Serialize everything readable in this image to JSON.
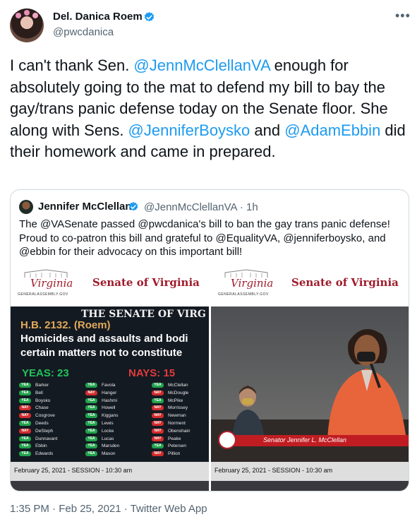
{
  "author": {
    "name": "Del. Danica Roem",
    "handle": "@pwcdanica"
  },
  "menu_icon": "more-horizontal-icon",
  "tweet": {
    "text_parts": [
      {
        "text": "I can't thank Sen. ",
        "mention": false
      },
      {
        "text": "@JennMcClellanVA",
        "mention": true
      },
      {
        "text": " enough for absolutely going to the mat to defend my bill to bay the gay/trans panic defense today on the Senate floor. She along with Sens. ",
        "mention": false
      },
      {
        "text": "@JenniferBoysko",
        "mention": true
      },
      {
        "text": " and ",
        "mention": false
      },
      {
        "text": "@AdamEbbin",
        "mention": true
      },
      {
        "text": " did their homework and came in prepared.",
        "mention": false
      }
    ]
  },
  "quote": {
    "name": "Jennifer McClellan",
    "handle_time": "@JennMcClellanVA · 1h",
    "text": "The @VASenate passed @pwcdanica's bill to ban the gay trans panic defense! Proud to co-patron this bill and grateful to @EqualityVA, @jenniferboysko, and @ebbin for their advocacy on this important bill!",
    "media": {
      "logo_script": "Virginia",
      "logo_small": "GENERALASSEMBLY.GOV",
      "senate_title": "Senate of Virginia",
      "vote_screen": {
        "title": "THE SENATE OF VIRG",
        "bill": "H.B. 2132. (Roem)",
        "desc_line1": "Homicides and assaults and bodi",
        "desc_line2": "certain matters not to constitute",
        "yeas": "YEAS: 23",
        "nays": "NAYS: 15",
        "columns": [
          [
            {
              "vote": "YEA",
              "name": "Barker"
            },
            {
              "vote": "YEA",
              "name": "Bell"
            },
            {
              "vote": "YEA",
              "name": "Boysko"
            },
            {
              "vote": "NAY",
              "name": "Chase"
            },
            {
              "vote": "NAY",
              "name": "Cosgrove"
            },
            {
              "vote": "YEA",
              "name": "Deeds"
            },
            {
              "vote": "NAY",
              "name": "DeSteph"
            },
            {
              "vote": "YEA",
              "name": "Dunnavant"
            },
            {
              "vote": "YEA",
              "name": "Ebbin"
            },
            {
              "vote": "YEA",
              "name": "Edwards"
            }
          ],
          [
            {
              "vote": "YEA",
              "name": "Favola"
            },
            {
              "vote": "NAY",
              "name": "Hanger"
            },
            {
              "vote": "YEA",
              "name": "Hashmi"
            },
            {
              "vote": "YEA",
              "name": "Howell"
            },
            {
              "vote": "YEA",
              "name": "Kiggans"
            },
            {
              "vote": "YEA",
              "name": "Lewis"
            },
            {
              "vote": "YEA",
              "name": "Locke"
            },
            {
              "vote": "YEA",
              "name": "Lucas"
            },
            {
              "vote": "YEA",
              "name": "Marsden"
            },
            {
              "vote": "YEA",
              "name": "Mason"
            }
          ],
          [
            {
              "vote": "YEA",
              "name": "McClellan"
            },
            {
              "vote": "NAY",
              "name": "McDougle"
            },
            {
              "vote": "YEA",
              "name": "McPike"
            },
            {
              "vote": "NAY",
              "name": "Morrissey"
            },
            {
              "vote": "NAY",
              "name": "Newman"
            },
            {
              "vote": "NAY",
              "name": "Norment"
            },
            {
              "vote": "NAY",
              "name": "Obenshain"
            },
            {
              "vote": "NAY",
              "name": "Peake"
            },
            {
              "vote": "YEA",
              "name": "Petersen"
            },
            {
              "vote": "NAY",
              "name": "Pillion"
            }
          ]
        ]
      },
      "caption": "Senator Jennifer L. McClellan",
      "date_left": "February 25, 2021 - SESSION - 10:30 am",
      "date_right": "February 25, 2021 - SESSION - 10:30 am"
    }
  },
  "footer": "1:35 PM · Feb 25, 2021 · Twitter Web App",
  "colors": {
    "mention": "#1d9bf0",
    "verified": "#1d9bf0",
    "yea": "#1fa24b",
    "nay": "#d12b2b"
  }
}
